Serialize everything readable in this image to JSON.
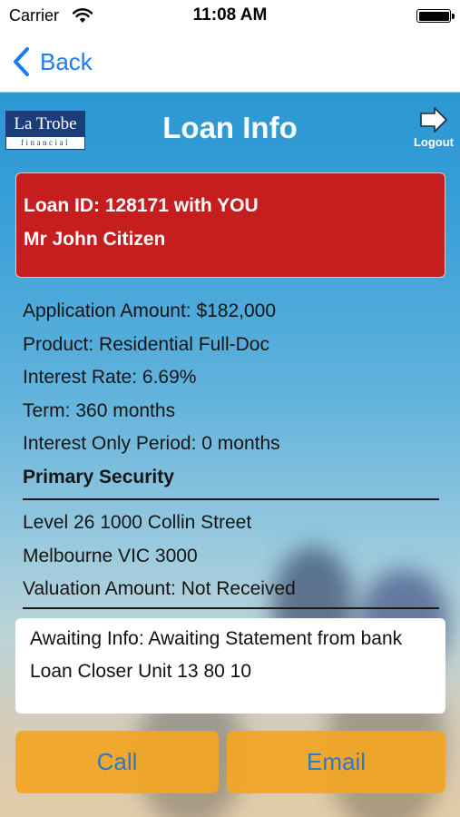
{
  "status_bar": {
    "carrier": "Carrier",
    "time": "11:08 AM"
  },
  "nav": {
    "back_label": "Back"
  },
  "header": {
    "title": "Loan Info",
    "logo_top": "La Trobe",
    "logo_bottom": "financial",
    "logout_label": "Logout"
  },
  "loan_card": {
    "id_line": "Loan ID: 128171 with YOU",
    "name_line": "Mr John Citizen",
    "color": "#c61d1f"
  },
  "details": {
    "application_amount": "Application Amount: $182,000",
    "product": "Product: Residential Full-Doc",
    "interest_rate": "Interest Rate: 6.69%",
    "term": "Term: 360 months",
    "interest_only_period": "Interest Only Period: 0 months"
  },
  "security": {
    "title": "Primary Security",
    "address_line1": "Level 26 1000 Collin Street",
    "address_line2": "Melbourne VIC 3000",
    "valuation": "Valuation Amount: Not Received"
  },
  "status": {
    "awaiting": "Awaiting Info: Awaiting Statement from bank",
    "unit": "Loan Closer Unit 13 80 10"
  },
  "actions": {
    "call_label": "Call",
    "email_label": "Email",
    "button_color": "#f2a523",
    "label_color": "#2b78cc"
  },
  "colors": {
    "accent": "#1a7cf5",
    "background_top": "#2b97d3"
  }
}
